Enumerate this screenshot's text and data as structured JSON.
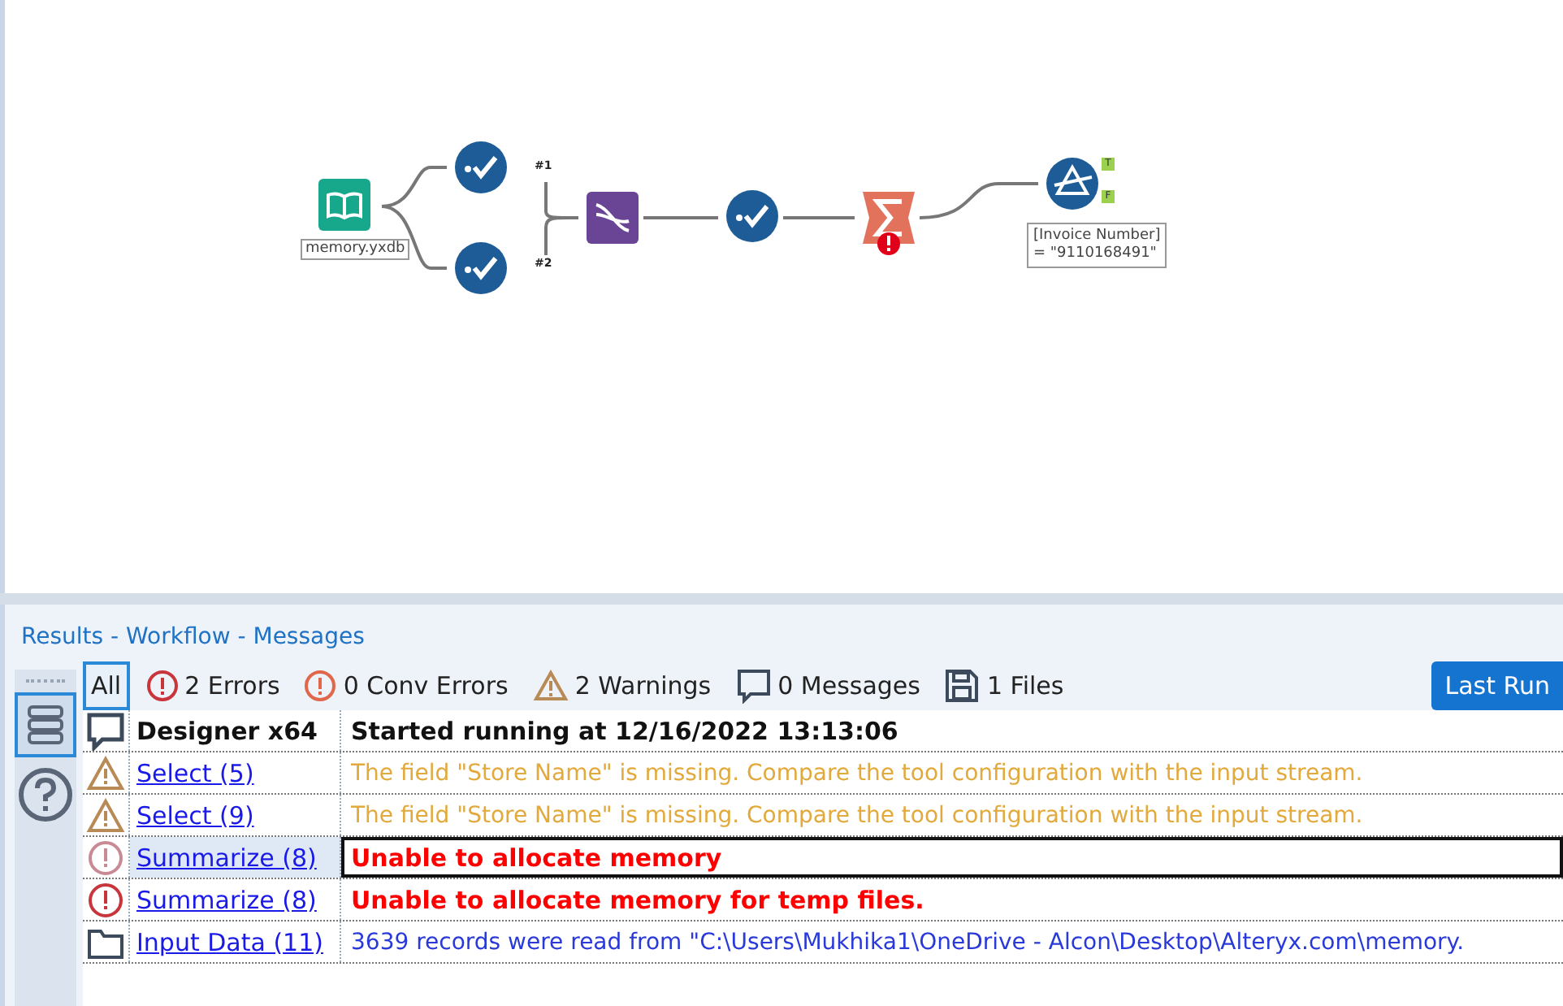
{
  "canvas": {
    "nodes": [
      {
        "kind": "input",
        "label": "memory.yxdb",
        "error": false
      },
      {
        "kind": "select",
        "error": false
      },
      {
        "kind": "select",
        "error": false
      },
      {
        "kind": "union",
        "error": false
      },
      {
        "kind": "select",
        "error": false
      },
      {
        "kind": "summarize",
        "error": true
      },
      {
        "kind": "filter",
        "label": "[Invoice Number]\n= \"9110168491\"",
        "error": false,
        "anchors": [
          "T",
          "F"
        ]
      }
    ],
    "connection_labels": [
      "#1",
      "#2"
    ]
  },
  "results": {
    "title": "Results - Workflow - Messages",
    "filters": [
      {
        "kind": "all",
        "label": "All",
        "selected": true
      },
      {
        "kind": "error",
        "label": "2 Errors",
        "selected": false
      },
      {
        "kind": "conv",
        "label": "0 Conv Errors",
        "selected": false
      },
      {
        "kind": "warning",
        "label": "2 Warnings",
        "selected": false
      },
      {
        "kind": "message",
        "label": "0 Messages",
        "selected": false
      },
      {
        "kind": "file",
        "label": "1 Files",
        "selected": false
      }
    ],
    "last_run": {
      "label": "Last Run",
      "selected": true
    },
    "rows": [
      {
        "kind": "message",
        "tool": "Designer x64",
        "text": "Started running at 12/16/2022 13:13:06",
        "selected": false
      },
      {
        "kind": "warning",
        "tool": "Select (5)",
        "text": "The field \"Store Name\" is missing. Compare the tool configuration with the input stream.",
        "selected": false
      },
      {
        "kind": "warning",
        "tool": "Select (9)",
        "text": "The field \"Store Name\" is missing. Compare the tool configuration with the input stream.",
        "selected": false
      },
      {
        "kind": "error",
        "tool": "Summarize (8)",
        "text": "Unable to allocate memory",
        "selected": true
      },
      {
        "kind": "error",
        "tool": "Summarize (8)",
        "text": "Unable to allocate memory for temp files.",
        "selected": false
      },
      {
        "kind": "file",
        "tool": "Input Data (11)",
        "text": "3639 records were read from \"C:\\Users\\Mukhika1\\OneDrive - Alcon\\Desktop\\Alteryx.com\\memory.",
        "selected": false
      }
    ]
  }
}
